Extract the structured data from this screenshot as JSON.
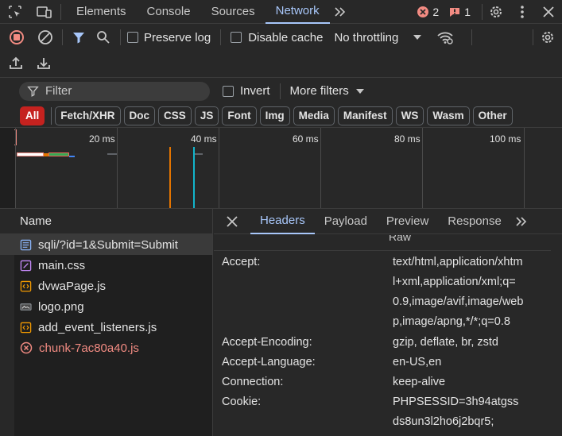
{
  "topbar": {
    "tabs": [
      "Elements",
      "Console",
      "Sources",
      "Network"
    ],
    "active_tab": "Network",
    "errors_count": "2",
    "issues_count": "1"
  },
  "toolbar": {
    "preserve_log": "Preserve log",
    "disable_cache": "Disable cache",
    "throttling": "No throttling"
  },
  "filter": {
    "placeholder": "Filter",
    "invert": "Invert",
    "more_filters": "More filters"
  },
  "types": [
    "All",
    "Fetch/XHR",
    "Doc",
    "CSS",
    "JS",
    "Font",
    "Img",
    "Media",
    "Manifest",
    "WS",
    "Wasm",
    "Other"
  ],
  "overview": {
    "ticks": [
      "20 ms",
      "40 ms",
      "60 ms",
      "80 ms",
      "100 ms"
    ]
  },
  "requests": {
    "header": "Name",
    "items": [
      {
        "name": "sqli/?id=1&Submit=Submit",
        "icon": "document-icon"
      },
      {
        "name": "main.css",
        "icon": "stylesheet-icon"
      },
      {
        "name": "dvwaPage.js",
        "icon": "script-icon"
      },
      {
        "name": "logo.png",
        "icon": "image-icon"
      },
      {
        "name": "add_event_listeners.js",
        "icon": "script-icon"
      },
      {
        "name": "chunk-7ac80a40.js",
        "icon": "error-icon"
      }
    ]
  },
  "details": {
    "tabs": [
      "Headers",
      "Payload",
      "Preview",
      "Response"
    ],
    "active_tab": "Headers",
    "raw_label": "Raw",
    "headers": [
      {
        "key": "Accept:",
        "value": "text/html,application/xhtml+xml,application/xml;q=0.9,image/avif,image/webp,image/apng,*/*;q=0.8"
      },
      {
        "key": "Accept-Encoding:",
        "value": "gzip, deflate, br, zstd"
      },
      {
        "key": "Accept-Language:",
        "value": "en-US,en"
      },
      {
        "key": "Connection:",
        "value": "keep-alive"
      },
      {
        "key": "Cookie:",
        "value": "PHPSESSID=3h94atgssds8un3l2ho6j2bqr5;"
      }
    ]
  },
  "colors": {
    "accent": "#a8c7fa",
    "error": "#f28b82",
    "record": "#f28b82"
  }
}
